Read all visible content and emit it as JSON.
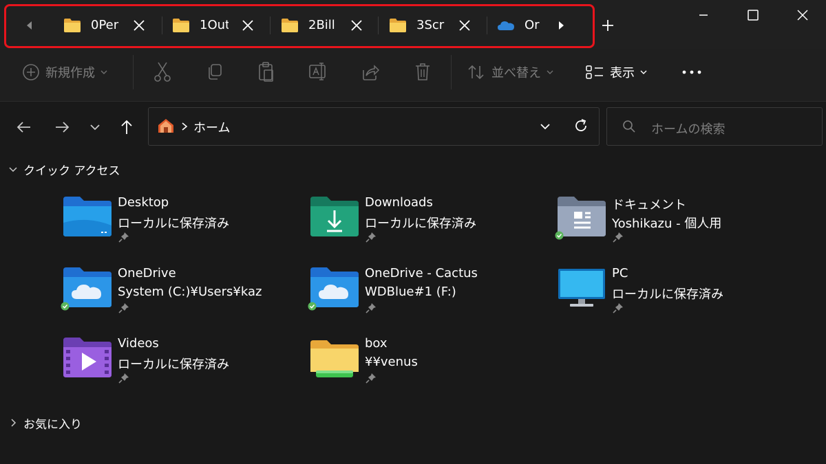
{
  "tabs": [
    {
      "label": "0Per",
      "icon": "folder-icon"
    },
    {
      "label": "1Out",
      "icon": "folder-icon"
    },
    {
      "label": "2Bill",
      "icon": "folder-icon"
    },
    {
      "label": "3Scr",
      "icon": "folder-icon"
    },
    {
      "label": "Or",
      "icon": "onedrive-icon"
    }
  ],
  "toolbar": {
    "new_label": "新規作成",
    "sort_label": "並べ替え",
    "view_label": "表示"
  },
  "address": {
    "path": "ホーム",
    "search_placeholder": "ホームの検索"
  },
  "sections": {
    "quick_access": "クイック アクセス",
    "favorites": "お気に入り"
  },
  "quick_access": [
    {
      "name": "Desktop",
      "sub": "ローカルに保存済み",
      "icon": "desktop-folder-icon",
      "synced": false
    },
    {
      "name": "Downloads",
      "sub": "ローカルに保存済み",
      "icon": "downloads-folder-icon",
      "synced": false
    },
    {
      "name": "ドキュメント",
      "sub": "Yoshikazu - 個人用",
      "icon": "documents-folder-icon",
      "synced": true
    },
    {
      "name": "OneDrive",
      "sub": "System (C:)¥Users¥kaz",
      "icon": "onedrive-folder-icon",
      "synced": true
    },
    {
      "name": "OneDrive - Cactus",
      "sub": "WDBlue#1 (F:)",
      "icon": "onedrive-folder-icon",
      "synced": true
    },
    {
      "name": "PC",
      "sub": "ローカルに保存済み",
      "icon": "pc-monitor-icon",
      "synced": false
    },
    {
      "name": "Videos",
      "sub": "ローカルに保存済み",
      "icon": "videos-folder-icon",
      "synced": false
    },
    {
      "name": "box",
      "sub": "¥¥venus",
      "icon": "network-folder-icon",
      "synced": false
    }
  ],
  "colors": {
    "background": "#191919",
    "highlight": "#e8141c",
    "folder_yellow": "#f5c84c",
    "sync_green": "#5bb55b"
  }
}
